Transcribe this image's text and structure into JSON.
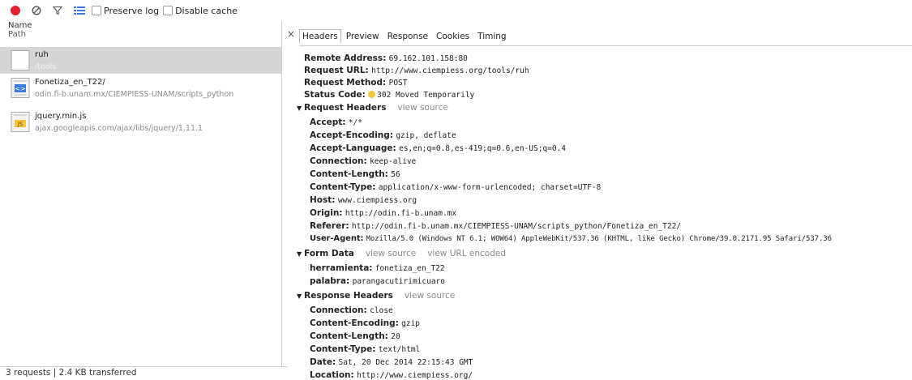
{
  "toolbar": {
    "preserve_log": "Preserve log",
    "disable_cache": "Disable cache"
  },
  "columns": {
    "name": "Name",
    "path": "Path"
  },
  "requests": [
    {
      "name": "ruh",
      "path": "/tools"
    },
    {
      "name": "Fonetiza_en_T22/",
      "path": "odin.fi-b.unam.mx/CIEMPIESS-UNAM/scripts_python"
    },
    {
      "name": "jquery.min.js",
      "path": "ajax.googleapis.com/ajax/libs/jquery/1.11.1"
    }
  ],
  "status_bar": "3 requests | 2.4 KB transferred",
  "tabs": [
    "Headers",
    "Preview",
    "Response",
    "Cookies",
    "Timing"
  ],
  "general": [
    {
      "k": "Remote Address:",
      "v": "69.162.101.158:80"
    },
    {
      "k": "Request URL:",
      "v": "http://www.ciempiess.org/tools/ruh"
    },
    {
      "k": "Request Method:",
      "v": "POST"
    },
    {
      "k": "Status Code:",
      "v": "302 Moved Temporarily"
    }
  ],
  "request_headers": {
    "title": "Request Headers",
    "link": "view source",
    "items": [
      {
        "k": "Accept:",
        "v": "*/*"
      },
      {
        "k": "Accept-Encoding:",
        "v": "gzip, deflate"
      },
      {
        "k": "Accept-Language:",
        "v": "es,en;q=0.8,es-419;q=0.6,en-US;q=0.4"
      },
      {
        "k": "Connection:",
        "v": "keep-alive"
      },
      {
        "k": "Content-Length:",
        "v": "56"
      },
      {
        "k": "Content-Type:",
        "v": "application/x-www-form-urlencoded; charset=UTF-8"
      },
      {
        "k": "Host:",
        "v": "www.ciempiess.org"
      },
      {
        "k": "Origin:",
        "v": "http://odin.fi-b.unam.mx"
      },
      {
        "k": "Referer:",
        "v": "http://odin.fi-b.unam.mx/CIEMPIESS-UNAM/scripts_python/Fonetiza_en_T22/"
      },
      {
        "k": "User-Agent:",
        "v": "Mozilla/5.0 (Windows NT 6.1; WOW64) AppleWebKit/537.36 (KHTML, like Gecko) Chrome/39.0.2171.95 Safari/537.36"
      }
    ]
  },
  "form_data": {
    "title": "Form Data",
    "link1": "view source",
    "link2": "view URL encoded",
    "items": [
      {
        "k": "herramienta:",
        "v": "fonetiza_en_T22"
      },
      {
        "k": "palabra:",
        "v": "parangacutirimicuaro"
      }
    ]
  },
  "response_headers": {
    "title": "Response Headers",
    "link": "view source",
    "items": [
      {
        "k": "Connection:",
        "v": "close"
      },
      {
        "k": "Content-Encoding:",
        "v": "gzip"
      },
      {
        "k": "Content-Length:",
        "v": "20"
      },
      {
        "k": "Content-Type:",
        "v": "text/html"
      },
      {
        "k": "Date:",
        "v": "Sat, 20 Dec 2014 22:15:43 GMT"
      },
      {
        "k": "Location:",
        "v": "http://www.ciempiess.org/"
      }
    ]
  },
  "colors": {
    "record": "#e5212c",
    "status_dot": "#f5c33b"
  }
}
